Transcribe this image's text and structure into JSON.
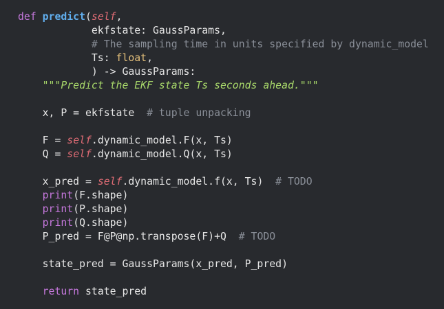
{
  "code_lines": [
    [
      {
        "cls": "kw",
        "text": "def "
      },
      {
        "cls": "fn",
        "text": "predict"
      },
      {
        "cls": "plain",
        "text": "("
      },
      {
        "cls": "self",
        "text": "self"
      },
      {
        "cls": "plain",
        "text": ","
      }
    ],
    [
      {
        "cls": "plain",
        "text": "            ekfstate: GaussParams,"
      }
    ],
    [
      {
        "cls": "cmt",
        "text": "            # The sampling time in units specified by dynamic_model"
      }
    ],
    [
      {
        "cls": "plain",
        "text": "            Ts: "
      },
      {
        "cls": "type",
        "text": "float"
      },
      {
        "cls": "plain",
        "text": ","
      }
    ],
    [
      {
        "cls": "plain",
        "text": "            ) -> GaussParams:"
      }
    ],
    [
      {
        "cls": "str",
        "text": "    \"\"\"Predict the EKF state Ts seconds ahead.\"\"\""
      }
    ],
    [
      {
        "cls": "plain",
        "text": ""
      }
    ],
    [
      {
        "cls": "plain",
        "text": "    x, P = ekfstate  "
      },
      {
        "cls": "cmt",
        "text": "# tuple unpacking"
      }
    ],
    [
      {
        "cls": "plain",
        "text": ""
      }
    ],
    [
      {
        "cls": "plain",
        "text": "    F = "
      },
      {
        "cls": "self",
        "text": "self"
      },
      {
        "cls": "plain",
        "text": ".dynamic_model.F(x, Ts)"
      }
    ],
    [
      {
        "cls": "plain",
        "text": "    Q = "
      },
      {
        "cls": "self",
        "text": "self"
      },
      {
        "cls": "plain",
        "text": ".dynamic_model.Q(x, Ts)"
      }
    ],
    [
      {
        "cls": "plain",
        "text": ""
      }
    ],
    [
      {
        "cls": "plain",
        "text": "    x_pred = "
      },
      {
        "cls": "self",
        "text": "self"
      },
      {
        "cls": "plain",
        "text": ".dynamic_model.f(x, Ts)  "
      },
      {
        "cls": "cmt",
        "text": "# TODO"
      }
    ],
    [
      {
        "cls": "plain",
        "text": "    "
      },
      {
        "cls": "kw",
        "text": "print"
      },
      {
        "cls": "plain",
        "text": "(F.shape)"
      }
    ],
    [
      {
        "cls": "plain",
        "text": "    "
      },
      {
        "cls": "kw",
        "text": "print"
      },
      {
        "cls": "plain",
        "text": "(P.shape)"
      }
    ],
    [
      {
        "cls": "plain",
        "text": "    "
      },
      {
        "cls": "kw",
        "text": "print"
      },
      {
        "cls": "plain",
        "text": "(Q.shape)"
      }
    ],
    [
      {
        "cls": "plain",
        "text": "    P_pred = F@P@np.transpose(F)+Q  "
      },
      {
        "cls": "cmt",
        "text": "# TODO"
      }
    ],
    [
      {
        "cls": "plain",
        "text": ""
      }
    ],
    [
      {
        "cls": "plain",
        "text": "    state_pred = GaussParams(x_pred, P_pred)"
      }
    ],
    [
      {
        "cls": "plain",
        "text": ""
      }
    ],
    [
      {
        "cls": "plain",
        "text": "    "
      },
      {
        "cls": "kw",
        "text": "return"
      },
      {
        "cls": "plain",
        "text": " state_pred"
      }
    ]
  ]
}
